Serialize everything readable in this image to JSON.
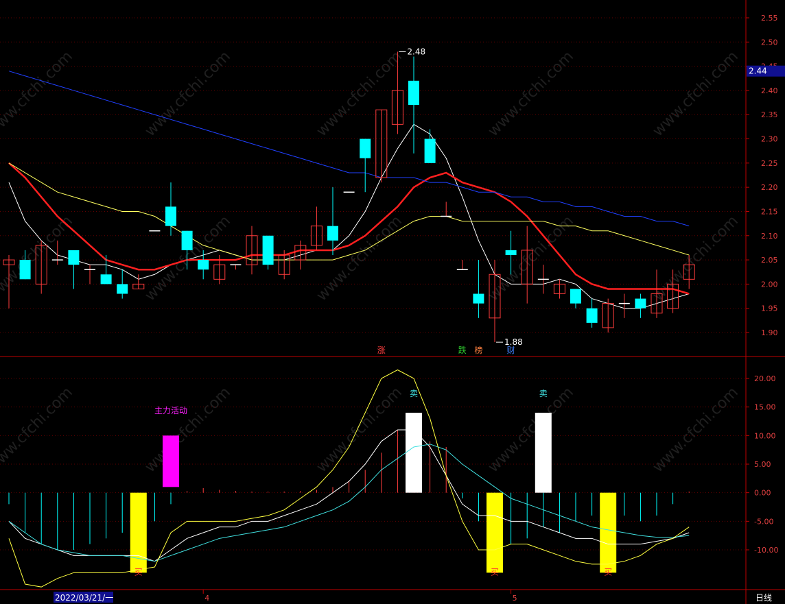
{
  "chart_data": [
    {
      "type": "candlestick",
      "panel": "price",
      "ylim": [
        1.86,
        2.58
      ],
      "y_ticks": [
        "2.55",
        "2.50",
        "2.45",
        "2.40",
        "2.35",
        "2.30",
        "2.25",
        "2.20",
        "2.15",
        "2.10",
        "2.05",
        "2.00",
        "1.95",
        "1.90"
      ],
      "current_price_label": "2.44",
      "candles": [
        {
          "o": 2.04,
          "h": 2.06,
          "l": 1.95,
          "c": 2.05
        },
        {
          "o": 2.05,
          "h": 2.07,
          "l": 2.01,
          "c": 2.01
        },
        {
          "o": 2.0,
          "h": 2.09,
          "l": 1.98,
          "c": 2.08
        },
        {
          "o": 2.05,
          "h": 2.09,
          "l": 2.04,
          "c": 2.05
        },
        {
          "o": 2.07,
          "h": 2.07,
          "l": 1.99,
          "c": 2.04
        },
        {
          "o": 2.03,
          "h": 2.04,
          "l": 2.0,
          "c": 2.03
        },
        {
          "o": 2.02,
          "h": 2.06,
          "l": 2.0,
          "c": 2.0
        },
        {
          "o": 2.0,
          "h": 2.03,
          "l": 1.97,
          "c": 1.98
        },
        {
          "o": 1.99,
          "h": 2.02,
          "l": 1.99,
          "c": 2.0
        },
        {
          "o": 2.11,
          "h": 2.11,
          "l": 2.11,
          "c": 2.11
        },
        {
          "o": 2.16,
          "h": 2.21,
          "l": 2.1,
          "c": 2.12
        },
        {
          "o": 2.11,
          "h": 2.11,
          "l": 2.03,
          "c": 2.07
        },
        {
          "o": 2.05,
          "h": 2.07,
          "l": 2.01,
          "c": 2.03
        },
        {
          "o": 2.01,
          "h": 2.06,
          "l": 2.0,
          "c": 2.04
        },
        {
          "o": 2.04,
          "h": 2.04,
          "l": 2.03,
          "c": 2.04
        },
        {
          "o": 2.04,
          "h": 2.12,
          "l": 2.02,
          "c": 2.1
        },
        {
          "o": 2.1,
          "h": 2.1,
          "l": 2.03,
          "c": 2.04
        },
        {
          "o": 2.02,
          "h": 2.07,
          "l": 2.01,
          "c": 2.06
        },
        {
          "o": 2.05,
          "h": 2.09,
          "l": 2.03,
          "c": 2.08
        },
        {
          "o": 2.08,
          "h": 2.16,
          "l": 2.07,
          "c": 2.12
        },
        {
          "o": 2.12,
          "h": 2.2,
          "l": 2.06,
          "c": 2.09
        },
        {
          "o": 2.19,
          "h": 2.19,
          "l": 2.19,
          "c": 2.19
        },
        {
          "o": 2.3,
          "h": 2.3,
          "l": 2.19,
          "c": 2.26
        },
        {
          "o": 2.22,
          "h": 2.36,
          "l": 2.21,
          "c": 2.36
        },
        {
          "o": 2.33,
          "h": 2.48,
          "l": 2.31,
          "c": 2.4
        },
        {
          "o": 2.42,
          "h": 2.47,
          "l": 2.27,
          "c": 2.37
        },
        {
          "o": 2.3,
          "h": 2.32,
          "l": 2.25,
          "c": 2.25
        },
        {
          "o": 2.14,
          "h": 2.17,
          "l": 2.14,
          "c": 2.14
        },
        {
          "o": 2.03,
          "h": 2.05,
          "l": 2.03,
          "c": 2.03
        },
        {
          "o": 1.98,
          "h": 2.05,
          "l": 1.93,
          "c": 1.96
        },
        {
          "o": 1.93,
          "h": 2.05,
          "l": 1.88,
          "c": 2.02
        },
        {
          "o": 2.07,
          "h": 2.11,
          "l": 2.02,
          "c": 2.06
        },
        {
          "o": 2.0,
          "h": 2.12,
          "l": 1.96,
          "c": 2.07
        },
        {
          "o": 2.01,
          "h": 2.04,
          "l": 1.98,
          "c": 2.01
        },
        {
          "o": 1.98,
          "h": 2.01,
          "l": 1.97,
          "c": 2.0
        },
        {
          "o": 1.99,
          "h": 1.99,
          "l": 1.95,
          "c": 1.96
        },
        {
          "o": 1.95,
          "h": 1.97,
          "l": 1.91,
          "c": 1.92
        },
        {
          "o": 1.91,
          "h": 1.97,
          "l": 1.9,
          "c": 1.96
        },
        {
          "o": 1.96,
          "h": 1.98,
          "l": 1.93,
          "c": 1.96
        },
        {
          "o": 1.97,
          "h": 1.98,
          "l": 1.93,
          "c": 1.95
        },
        {
          "o": 1.94,
          "h": 2.03,
          "l": 1.93,
          "c": 1.98
        },
        {
          "o": 1.95,
          "h": 2.03,
          "l": 1.94,
          "c": 2.0
        },
        {
          "o": 2.01,
          "h": 2.06,
          "l": 1.99,
          "c": 2.04
        }
      ],
      "ma_series": [
        {
          "color": "#ffffff",
          "values": [
            2.21,
            2.13,
            2.09,
            2.06,
            2.05,
            2.04,
            2.04,
            2.03,
            2.01,
            2.02,
            2.04,
            2.05,
            2.06,
            2.07,
            2.06,
            2.05,
            2.05,
            2.05,
            2.06,
            2.07,
            2.07,
            2.1,
            2.15,
            2.22,
            2.28,
            2.33,
            2.31,
            2.26,
            2.18,
            2.09,
            2.02,
            2.0,
            2.0,
            2.0,
            2.01,
            2.0,
            1.97,
            1.96,
            1.95,
            1.95,
            1.96,
            1.97,
            1.98
          ]
        },
        {
          "color": "#ff2020",
          "values": [
            2.25,
            2.22,
            2.18,
            2.14,
            2.11,
            2.08,
            2.05,
            2.04,
            2.03,
            2.03,
            2.04,
            2.05,
            2.05,
            2.05,
            2.05,
            2.06,
            2.06,
            2.06,
            2.07,
            2.07,
            2.07,
            2.08,
            2.1,
            2.13,
            2.16,
            2.2,
            2.22,
            2.23,
            2.21,
            2.2,
            2.19,
            2.17,
            2.14,
            2.1,
            2.06,
            2.02,
            2.0,
            1.99,
            1.99,
            1.99,
            1.99,
            1.99,
            1.98
          ]
        },
        {
          "color": "#ffff60",
          "values": [
            2.25,
            2.23,
            2.21,
            2.19,
            2.18,
            2.17,
            2.16,
            2.15,
            2.15,
            2.14,
            2.12,
            2.1,
            2.08,
            2.07,
            2.06,
            2.05,
            2.05,
            2.05,
            2.05,
            2.05,
            2.05,
            2.06,
            2.07,
            2.09,
            2.11,
            2.13,
            2.14,
            2.14,
            2.13,
            2.13,
            2.13,
            2.13,
            2.13,
            2.13,
            2.12,
            2.12,
            2.11,
            2.11,
            2.1,
            2.09,
            2.08,
            2.07,
            2.06
          ]
        },
        {
          "color": "#2040ff",
          "values": [
            2.44,
            2.43,
            2.42,
            2.41,
            2.4,
            2.39,
            2.38,
            2.37,
            2.36,
            2.35,
            2.34,
            2.33,
            2.32,
            2.31,
            2.3,
            2.29,
            2.28,
            2.27,
            2.26,
            2.25,
            2.24,
            2.23,
            2.23,
            2.22,
            2.22,
            2.22,
            2.21,
            2.21,
            2.2,
            2.19,
            2.19,
            2.18,
            2.18,
            2.17,
            2.17,
            2.16,
            2.16,
            2.15,
            2.14,
            2.14,
            2.13,
            2.13,
            2.12
          ]
        }
      ],
      "annotations": [
        {
          "text": "2.48",
          "candle": 24,
          "value": 2.48,
          "side": "right"
        },
        {
          "text": "1.88",
          "candle": 30,
          "value": 1.88,
          "side": "right"
        }
      ],
      "event_tags": [
        {
          "text": "涨",
          "candle": 23,
          "color": "#ff4040"
        },
        {
          "text": "跌",
          "candle": 28,
          "color": "#30d030"
        },
        {
          "text": "榜",
          "candle": 29,
          "color": "#ff8040"
        },
        {
          "text": "财",
          "candle": 31,
          "color": "#4080ff"
        }
      ]
    },
    {
      "type": "indicator",
      "panel": "oscillator",
      "ylim": [
        -17.0,
        25.0
      ],
      "y_ticks": [
        "20.00",
        "15.00",
        "10.00",
        "5.00",
        "0.00",
        "-5.00",
        "-10.00"
      ],
      "histogram": [
        -2,
        -7,
        -9,
        -10,
        -10,
        -9,
        -8,
        -7,
        -6,
        -5,
        -2,
        0.3,
        0.8,
        0.5,
        0.3,
        0.2,
        0.2,
        0.2,
        0.3,
        0.5,
        1,
        2,
        4,
        7,
        11,
        10,
        9,
        8,
        -1,
        -5,
        -8,
        -9,
        -8,
        -6,
        -7,
        -5,
        -4,
        -6,
        -4,
        -5,
        -4,
        -2,
        0.2
      ],
      "series": [
        {
          "color": "#ffffff",
          "values": [
            -5,
            -8,
            -9,
            -10,
            -11,
            -11,
            -11,
            -11,
            -11,
            -12,
            -10,
            -8,
            -7,
            -6,
            -6,
            -5,
            -5,
            -4,
            -3,
            -2,
            0,
            2,
            5,
            9,
            11,
            11,
            8,
            3,
            -2,
            -4,
            -4,
            -5,
            -5,
            -6,
            -7,
            -8,
            -8,
            -9,
            -9,
            -9,
            -8.5,
            -8,
            -7
          ]
        },
        {
          "color": "#40e0e0",
          "values": [
            -5,
            -7,
            -9,
            -10,
            -10.5,
            -11,
            -11,
            -11,
            -11.5,
            -12,
            -11,
            -10,
            -9,
            -8,
            -7.5,
            -7,
            -6.5,
            -6,
            -5,
            -4,
            -3,
            -1.5,
            1,
            4,
            6,
            8,
            8.5,
            7.5,
            5,
            3,
            1,
            -1,
            -2,
            -3,
            -4,
            -5,
            -6,
            -6.5,
            -7,
            -7.5,
            -7.8,
            -7.8,
            -7.5
          ]
        },
        {
          "color": "#ffff40",
          "values": [
            -8,
            -16,
            -16.5,
            -15,
            -14,
            -14,
            -14,
            -14,
            -13.5,
            -13,
            -7,
            -5,
            -5,
            -5,
            -5,
            -4.5,
            -4,
            -3,
            -1,
            1,
            4,
            8,
            14,
            20,
            21.5,
            20,
            13,
            3,
            -5,
            -10,
            -10,
            -9,
            -9,
            -10,
            -11,
            -12,
            -12.5,
            -12.5,
            -12,
            -11,
            -9,
            -8,
            -6
          ]
        }
      ],
      "signal_bars": [
        {
          "type": "buy",
          "candle": 8,
          "from": 0,
          "to": -14,
          "color": "#ffff00"
        },
        {
          "type": "activity",
          "candle": 10,
          "from": 1,
          "to": 10,
          "color": "#ff00ff"
        },
        {
          "type": "sell",
          "candle": 25,
          "from": 0,
          "to": 14,
          "color": "#ffffff"
        },
        {
          "type": "buy",
          "candle": 30,
          "from": 0,
          "to": -14,
          "color": "#ffff00"
        },
        {
          "type": "sell",
          "candle": 33,
          "from": 0,
          "to": 14,
          "color": "#ffffff"
        },
        {
          "type": "buy",
          "candle": 37,
          "from": 0,
          "to": -14,
          "color": "#ffff00"
        }
      ],
      "labels": [
        {
          "text": "主力活动",
          "candle": 10,
          "value": 14.5,
          "color": "#ff20ff"
        },
        {
          "text": "卖",
          "candle": 25,
          "value": 17.5,
          "color": "#40e0e0"
        },
        {
          "text": "卖",
          "candle": 33,
          "value": 17.5,
          "color": "#40e0e0"
        },
        {
          "text": "买",
          "candle": 8,
          "value": -13.8,
          "color": "#ff3030"
        },
        {
          "text": "买",
          "candle": 30,
          "value": -13.8,
          "color": "#ff3030"
        },
        {
          "text": "买",
          "candle": 37,
          "value": -13.8,
          "color": "#ff3030"
        }
      ]
    }
  ],
  "x_axis": {
    "date_label": "2022/03/21/一",
    "month_marks": [
      {
        "text": "4",
        "candle": 12
      },
      {
        "text": "5",
        "candle": 31
      }
    ]
  },
  "period_label": "日线",
  "watermark": "www.cfchi.com",
  "colors": {
    "up": "#ff3c3c",
    "down": "#00ffff",
    "axis": "#c00000",
    "grid": "#600000"
  }
}
